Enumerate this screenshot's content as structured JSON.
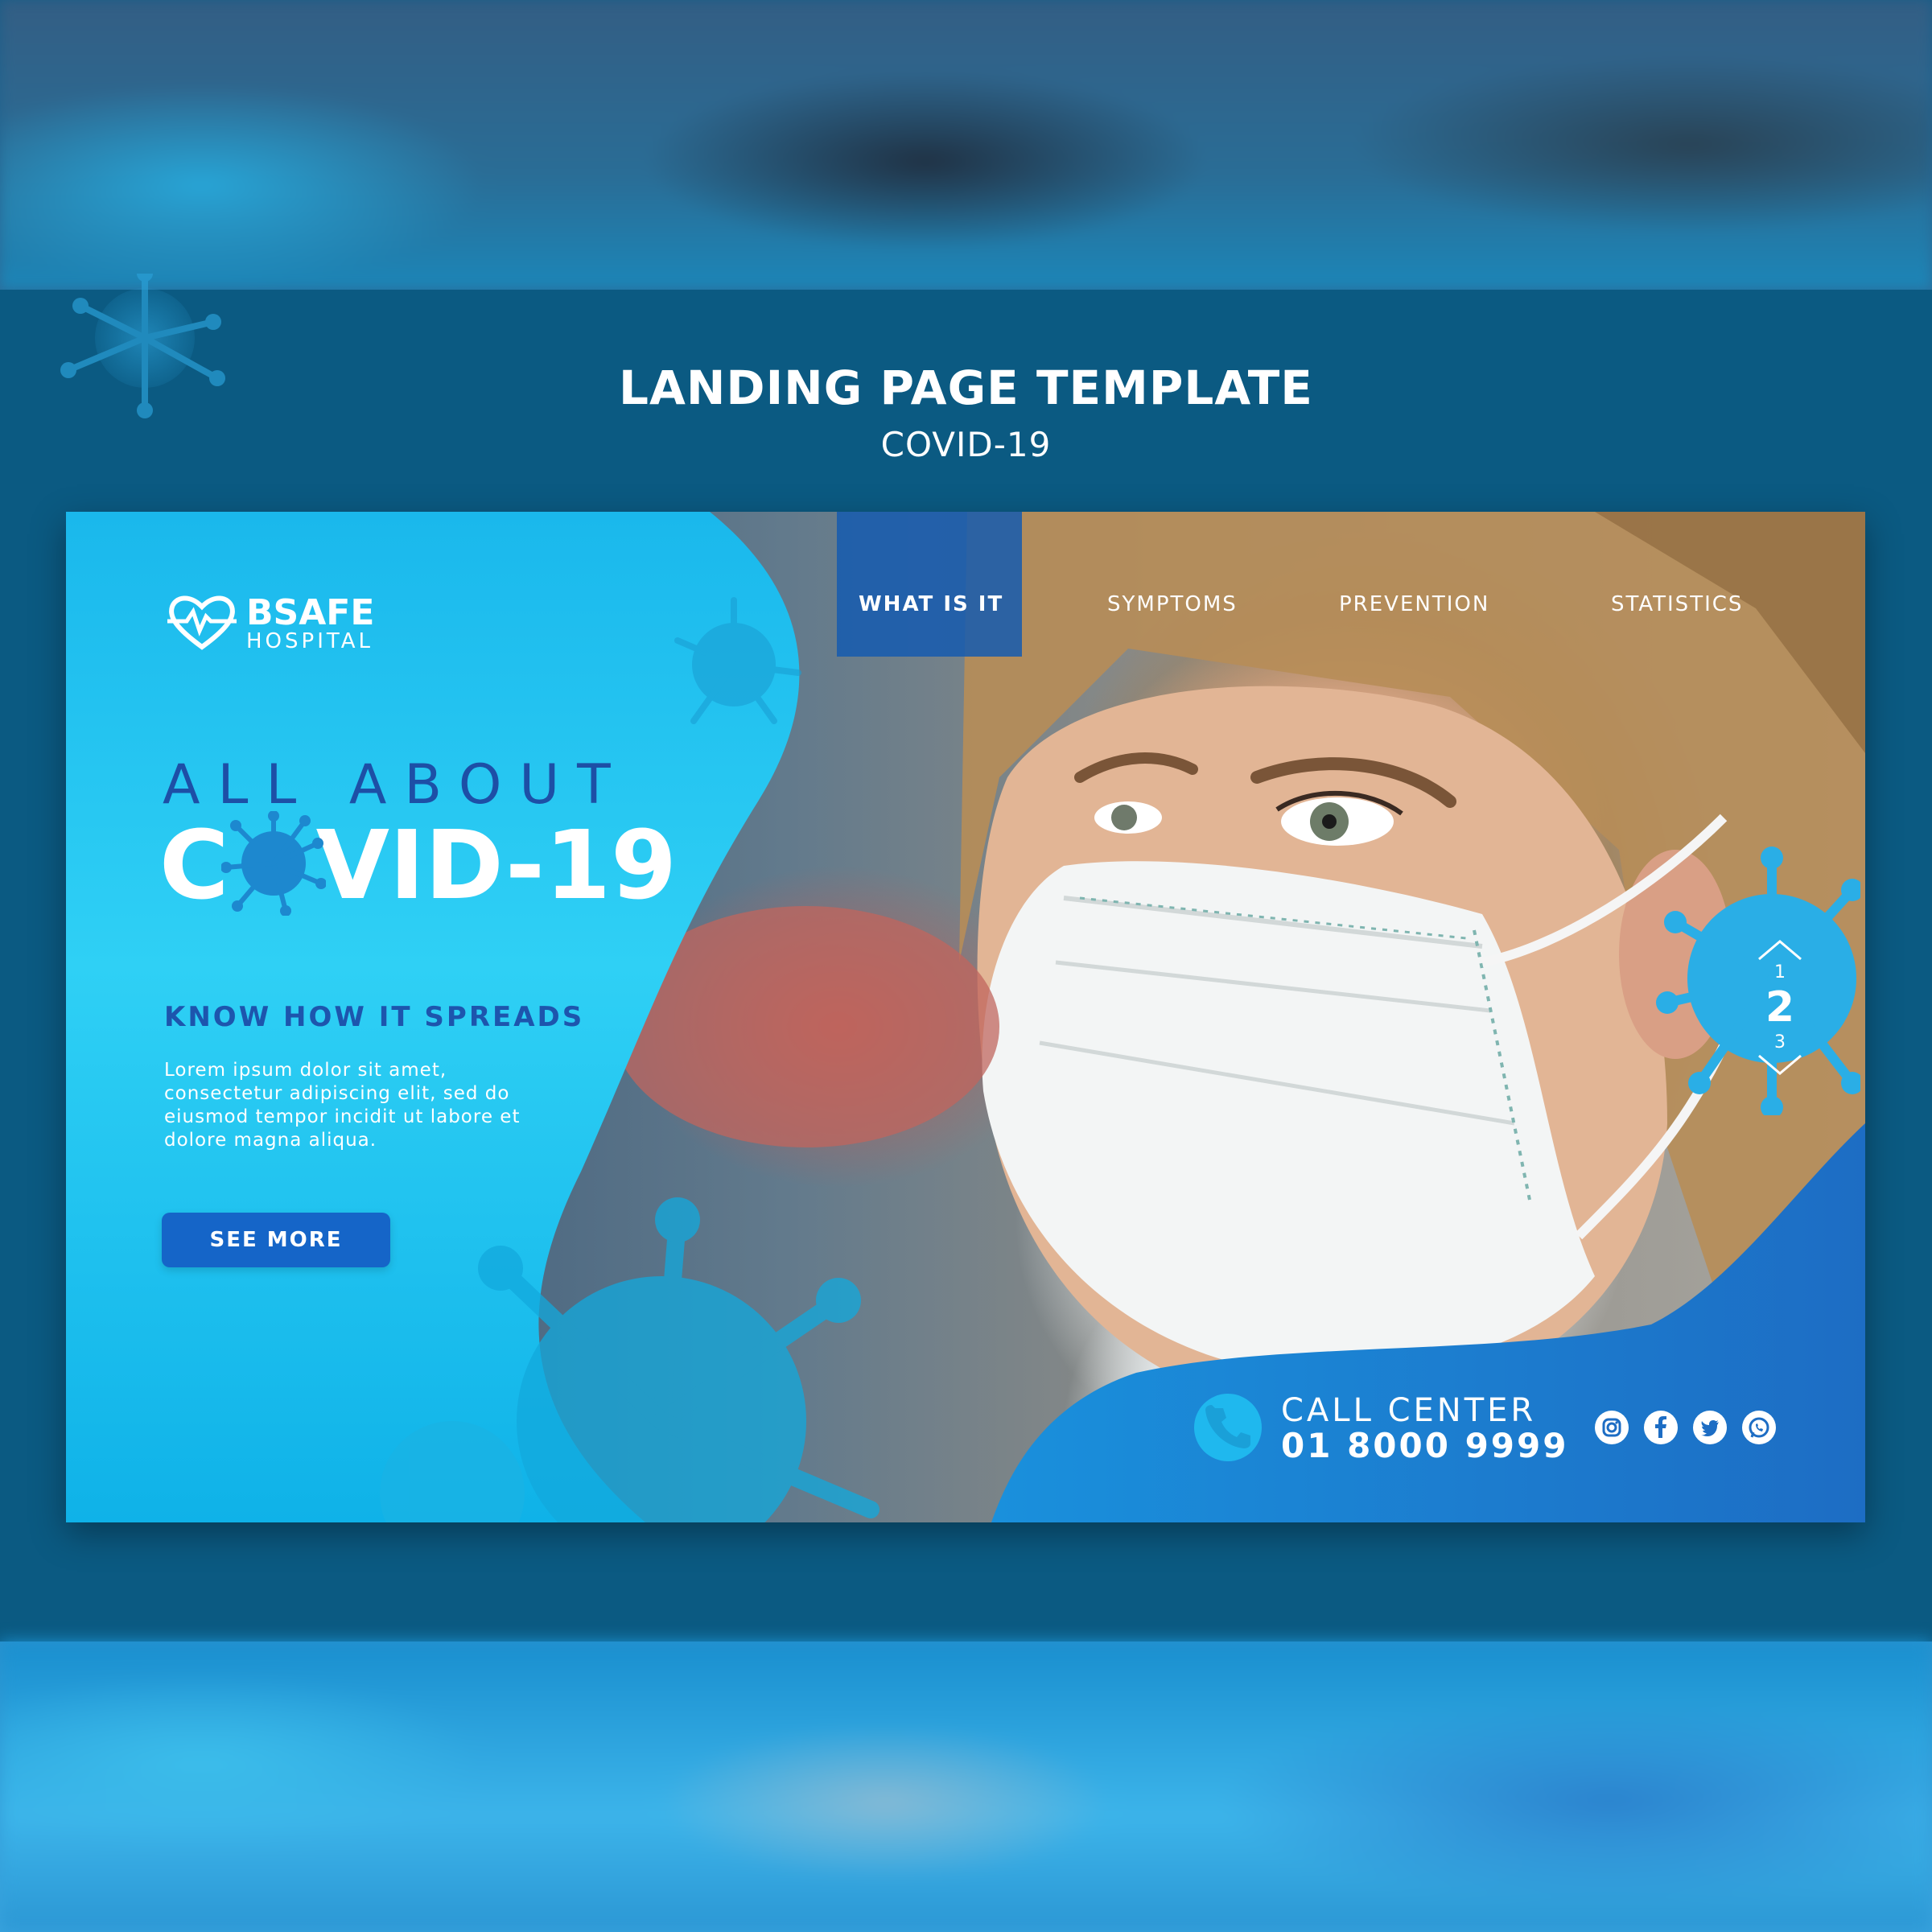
{
  "preview": {
    "title": "LANDING PAGE TEMPLATE",
    "subtitle": "COVID-19"
  },
  "brand": {
    "name": "BSAFE",
    "subname": "HOSPITAL",
    "logo_icon": "heart-pulse-icon"
  },
  "nav": {
    "items": [
      {
        "label": "WHAT IS IT",
        "active": true
      },
      {
        "label": "SYMPTOMS",
        "active": false
      },
      {
        "label": "PREVENTION",
        "active": false
      },
      {
        "label": "STATISTICS",
        "active": false
      }
    ]
  },
  "hero": {
    "line1": "ALL ABOUT",
    "line2_prefix": "C",
    "line2_suffix": "VID-19",
    "tagline": "KNOW HOW IT SPREADS",
    "body": "Lorem ipsum dolor sit amet, consectetur adipiscing elit, sed do eiusmod tempor incidit ut labore et dolore magna aliqua.",
    "cta_label": "SEE MORE"
  },
  "pager": {
    "prev": "1",
    "current": "2",
    "next": "3"
  },
  "contact": {
    "label": "CALL CENTER",
    "number": "01 8000 9999",
    "icon": "phone-icon"
  },
  "social": [
    "instagram-icon",
    "facebook-icon",
    "twitter-icon",
    "whatsapp-icon"
  ],
  "colors": {
    "frame": "#0b5a82",
    "panel_cyan": "#0fb0e6",
    "accent_blue": "#1565c8",
    "tagline_blue": "#1d55ad",
    "virus": "#2a9fd6"
  }
}
